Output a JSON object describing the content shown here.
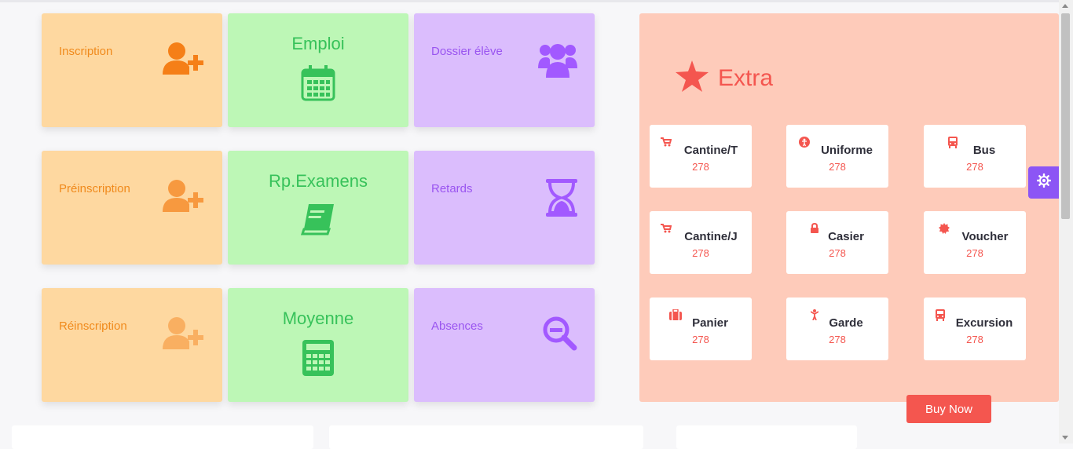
{
  "tiles": {
    "inscription": {
      "label": "Inscription",
      "icon": "user-plus-icon"
    },
    "emploi": {
      "label": "Emploi",
      "icon": "calendar-icon"
    },
    "dossier": {
      "label": "Dossier élève",
      "icon": "users-icon"
    },
    "preinscription": {
      "label": "Préinscription",
      "icon": "user-plus-icon"
    },
    "rpexamens": {
      "label": "Rp.Examens",
      "icon": "book-icon"
    },
    "retards": {
      "label": "Retards",
      "icon": "hourglass-icon"
    },
    "reinscription": {
      "label": "Réinscription",
      "icon": "user-plus-icon"
    },
    "moyenne": {
      "label": "Moyenne",
      "icon": "calculator-icon"
    },
    "absences": {
      "label": "Absences",
      "icon": "search-minus-icon"
    }
  },
  "extra": {
    "title": "Extra",
    "icon": "star-icon",
    "items": [
      {
        "name": "Cantine/T",
        "count": "278",
        "icon": "cart-icon"
      },
      {
        "name": "Uniforme",
        "count": "278",
        "icon": "accessibility-icon"
      },
      {
        "name": "Bus",
        "count": "278",
        "icon": "bus-icon"
      },
      {
        "name": "Cantine/J",
        "count": "278",
        "icon": "cart-icon"
      },
      {
        "name": "Casier",
        "count": "278",
        "icon": "lock-icon"
      },
      {
        "name": "Voucher",
        "count": "278",
        "icon": "badge-icon"
      },
      {
        "name": "Panier",
        "count": "278",
        "icon": "briefcase-icon"
      },
      {
        "name": "Garde",
        "count": "278",
        "icon": "child-icon"
      },
      {
        "name": "Excursion",
        "count": "278",
        "icon": "bus-icon"
      }
    ]
  },
  "buy_now": "Buy Now",
  "colors": {
    "orange_tile": "#fed8a0",
    "orange_text": "#f08a1c",
    "green_tile": "#bdf7b6",
    "green_text": "#37c25a",
    "purple_tile": "#dbbdfd",
    "purple_text": "#9a55f0",
    "extra_panel": "#fecbba",
    "accent_red": "#f4564f",
    "settings_button": "#8c55f5"
  }
}
